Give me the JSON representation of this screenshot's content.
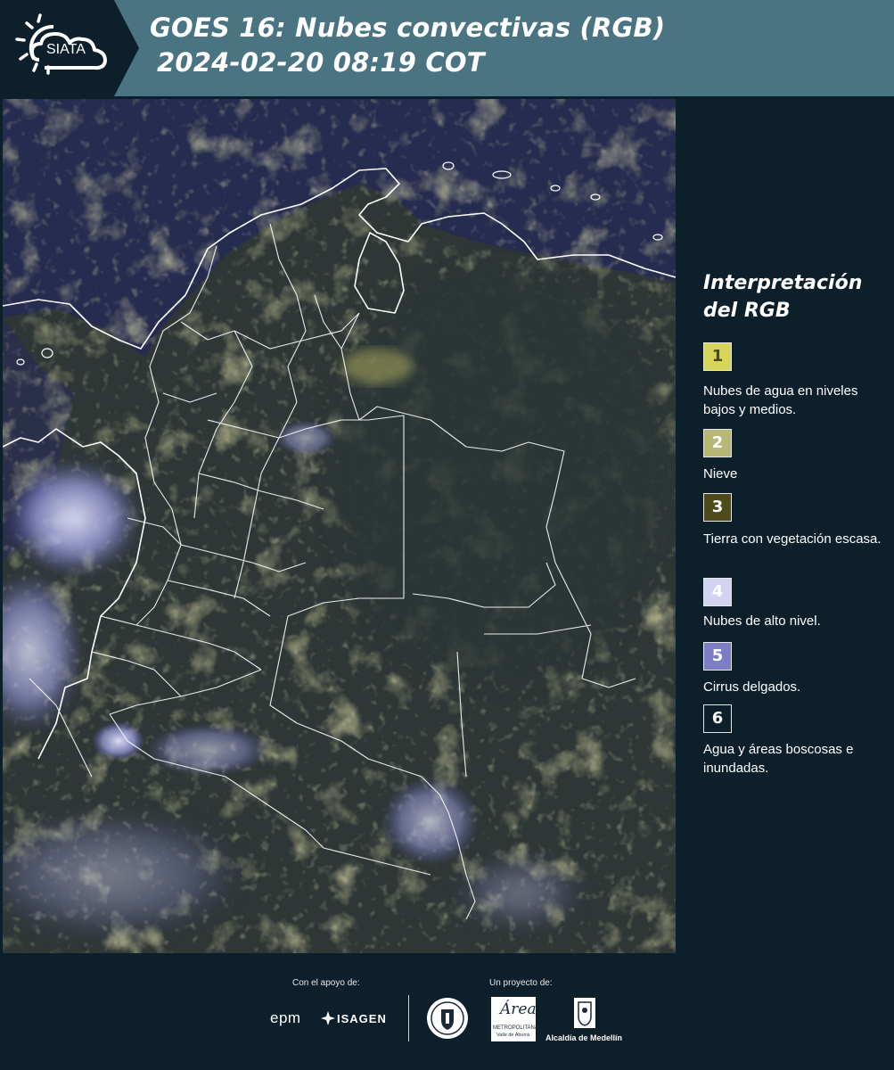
{
  "header": {
    "logo_text": "SIATA",
    "title_line1": "GOES 16: Nubes convectivas (RGB)",
    "title_line2": "2024-02-20 08:19 COT"
  },
  "legend": {
    "title": "Interpretación del RGB",
    "items": [
      {
        "number": "1",
        "label": "Nubes de agua en niveles bajos y medios.",
        "color": "#d8d65a",
        "text_color": "#4a4a20"
      },
      {
        "number": "2",
        "label": "Nieve",
        "color": "#b9b775",
        "text_color": "#ffffff"
      },
      {
        "number": "3",
        "label": "Tierra con vegetación escasa.",
        "color": "#4e4a1c",
        "text_color": "#ffffff"
      },
      {
        "number": "4",
        "label": "Nubes de alto nivel.",
        "color": "#d2d3f2",
        "text_color": "#ffffff"
      },
      {
        "number": "5",
        "label": "Cirrus delgados.",
        "color": "#7b7ec4",
        "text_color": "#ffffff"
      },
      {
        "number": "6",
        "label": "Agua y áreas boscosas e inundadas.",
        "color": "#0d1f2b",
        "text_color": "#ffffff"
      }
    ]
  },
  "footer": {
    "support_label": "Con el apoyo de:",
    "project_label": "Un proyecto de:",
    "epm_logo": "epm",
    "isagen_logo": "ISAGEN",
    "area_logo": "Área",
    "area_sub": "METROPOLITANA",
    "area_sub2": "Valle de Aburrá",
    "alcaldia_logo": "Alcaldía de Medellín"
  },
  "map": {
    "icon": "satellite-image",
    "colors": {
      "sea": "#262c4f",
      "land": "#2b3434",
      "cloud_yellow": "#c8c46a",
      "cloud_blue": "#b7b9ee"
    }
  }
}
